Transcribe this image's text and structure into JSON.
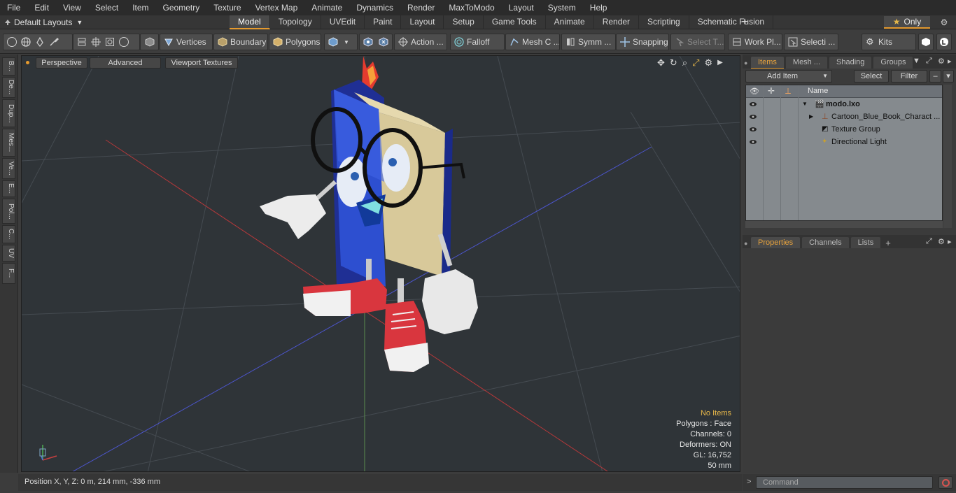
{
  "menu": [
    "File",
    "Edit",
    "View",
    "Select",
    "Item",
    "Geometry",
    "Texture",
    "Vertex Map",
    "Animate",
    "Dynamics",
    "Render",
    "MaxToModo",
    "Layout",
    "System",
    "Help"
  ],
  "layout_select": "Default Layouts",
  "tabs": [
    "Model",
    "Topology",
    "UVEdit",
    "Paint",
    "Layout",
    "Setup",
    "Game Tools",
    "Animate",
    "Render",
    "Scripting",
    "Schematic Fusion"
  ],
  "tab_add": "+",
  "only_label": "Only",
  "toolbar": {
    "vertices": "Vertices",
    "boundary": "Boundary",
    "polygons": "Polygons",
    "action": "Action ...",
    "falloff": "Falloff",
    "mesh": "Mesh C ...",
    "symm": "Symm ...",
    "snapping": "Snapping",
    "select_t": "Select T...",
    "work_pl": "Work Pl...",
    "selecti": "Selecti ...",
    "kits": "Kits"
  },
  "left_strip": [
    "B...",
    "De...",
    "Dup...",
    "Mes...",
    "Ve...",
    "E...",
    "Pol...",
    "C...",
    "UV",
    "F..."
  ],
  "viewport": {
    "perspective": "Perspective",
    "advanced": "Advanced",
    "textures": "Viewport Textures",
    "stats": {
      "no_items": "No Items",
      "polygons": "Polygons : Face",
      "channels": "Channels: 0",
      "deformers": "Deformers: ON",
      "gl": "GL: 16,752",
      "distance": "50 mm"
    }
  },
  "status": "Position X, Y, Z:  0 m, 214 mm, -336 mm",
  "items_panel": {
    "tabs": [
      "Items",
      "Mesh ...",
      "Shading",
      "Groups"
    ],
    "add_item": "Add Item",
    "select": "Select",
    "filter": "Filter",
    "header_name": "Name",
    "rows": [
      "modo.lxo",
      "Cartoon_Blue_Book_Charact ...",
      "Texture Group",
      "Directional Light"
    ]
  },
  "props_panel": {
    "tabs": [
      "Properties",
      "Channels",
      "Lists"
    ],
    "add": "+"
  },
  "command_placeholder": "Command",
  "colors": {
    "accent": "#e59a2e",
    "book_blue": "#2d4fd0",
    "shoe_red": "#d9363e"
  }
}
